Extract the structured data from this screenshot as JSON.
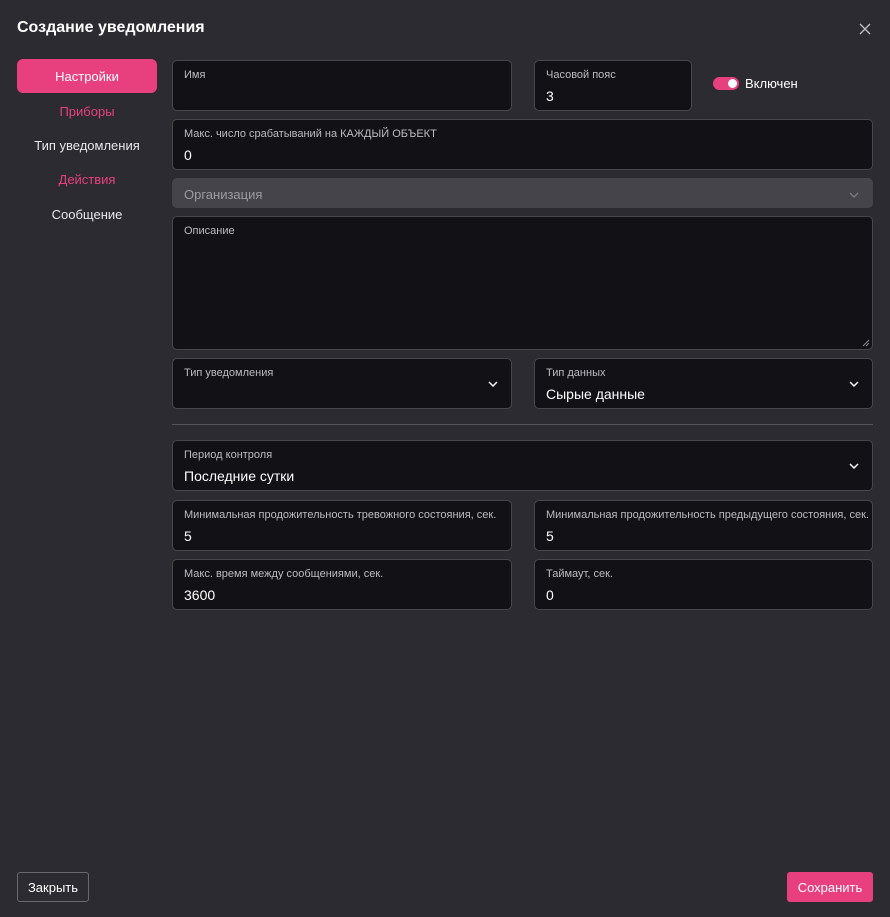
{
  "dialog": {
    "title": "Создание уведомления"
  },
  "sidebar": {
    "items": [
      {
        "label": "Настройки"
      },
      {
        "label": "Приборы"
      },
      {
        "label": "Тип уведомления"
      },
      {
        "label": "Действия"
      },
      {
        "label": "Сообщение"
      }
    ]
  },
  "form": {
    "name": {
      "label": "Имя",
      "value": ""
    },
    "timezone": {
      "label": "Часовой пояс",
      "value": "3"
    },
    "enabled": {
      "label": "Включен",
      "on": true
    },
    "max_triggers": {
      "label": "Макс. число срабатываний на КАЖДЫЙ ОБЪЕКТ",
      "value": "0"
    },
    "organization": {
      "placeholder": "Организация"
    },
    "description": {
      "label": "Описание",
      "value": ""
    },
    "notification_type": {
      "label": "Тип уведомления",
      "value": ""
    },
    "data_type": {
      "label": "Тип данных",
      "value": "Сырые данные"
    },
    "control_period": {
      "label": "Период контроля",
      "value": "Последние сутки"
    },
    "min_alarm_duration": {
      "label": "Минимальная продожительность тревожного состояния, сек.",
      "value": "5"
    },
    "min_prev_duration": {
      "label": "Минимальная продожительность предыдущего состояния, сек.",
      "value": "5"
    },
    "max_msg_interval": {
      "label": "Макс. время между сообщениями, сек.",
      "value": "3600"
    },
    "timeout": {
      "label": "Таймаут, сек.",
      "value": "0"
    }
  },
  "footer": {
    "close_label": "Закрыть",
    "save_label": "Сохранить"
  },
  "colors": {
    "accent": "#e8407f",
    "background": "#2c2b31",
    "field_bg": "#121116"
  }
}
